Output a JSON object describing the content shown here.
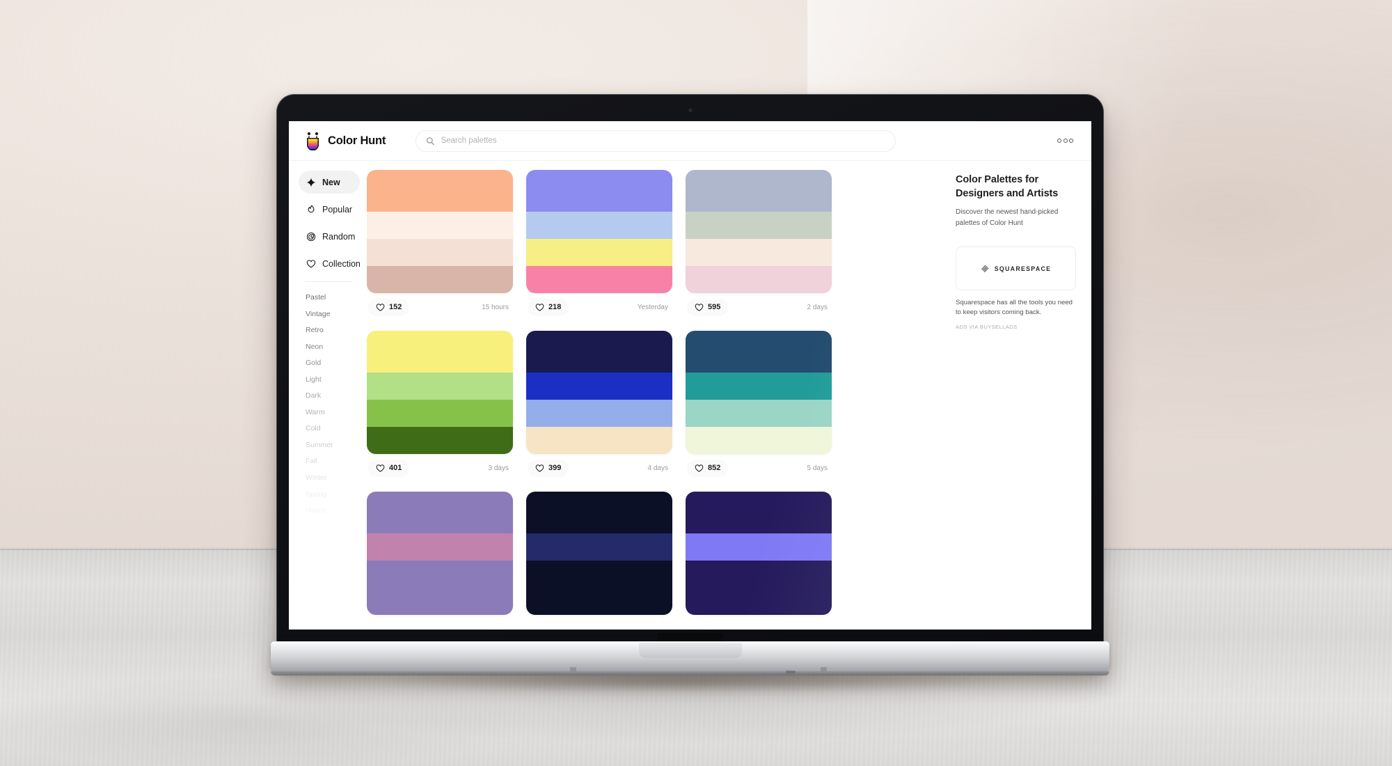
{
  "app": {
    "brand_name": "Color Hunt",
    "menu_icon": "more-horizontal-icon"
  },
  "search": {
    "placeholder": "Search palettes",
    "value": "",
    "icon": "search-icon"
  },
  "sidebar": {
    "nav": [
      {
        "label": "New",
        "icon": "sparkle-icon",
        "active": true
      },
      {
        "label": "Popular",
        "icon": "flame-icon",
        "active": false
      },
      {
        "label": "Random",
        "icon": "spiral-icon",
        "active": false
      },
      {
        "label": "Collection",
        "icon": "heart-icon",
        "active": false
      }
    ],
    "tags": [
      {
        "label": "Pastel",
        "opacity": 1.0
      },
      {
        "label": "Vintage",
        "opacity": 0.95
      },
      {
        "label": "Retro",
        "opacity": 0.9
      },
      {
        "label": "Neon",
        "opacity": 0.84
      },
      {
        "label": "Gold",
        "opacity": 0.76
      },
      {
        "label": "Light",
        "opacity": 0.68
      },
      {
        "label": "Dark",
        "opacity": 0.6
      },
      {
        "label": "Warm",
        "opacity": 0.52
      },
      {
        "label": "Cold",
        "opacity": 0.44
      },
      {
        "label": "Summer",
        "opacity": 0.34
      },
      {
        "label": "Fall",
        "opacity": 0.26
      },
      {
        "label": "Winter",
        "opacity": 0.18
      },
      {
        "label": "Spring",
        "opacity": 0.11
      },
      {
        "label": "Happy",
        "opacity": 0.06
      }
    ]
  },
  "palettes": [
    {
      "likes": "152",
      "time": "15 hours",
      "colors": [
        "#FAB38B",
        "#FDEFE5",
        "#F5E0D5",
        "#D8B5A8"
      ]
    },
    {
      "likes": "218",
      "time": "Yesterday",
      "colors": [
        "#8C8BF0",
        "#B4CBEF",
        "#F7EE85",
        "#F882A7"
      ]
    },
    {
      "likes": "595",
      "time": "2 days",
      "colors": [
        "#AEB7CC",
        "#C7D2C4",
        "#F7E9DD",
        "#EFD2DA"
      ]
    },
    {
      "likes": "401",
      "time": "3 days",
      "colors": [
        "#F8F07C",
        "#B1E086",
        "#86C council",
        "#3F6D17"
      ]
    },
    {
      "likes": "399",
      "time": "4 days",
      "colors": [
        "#1B1martin",
        "#1C2FC4",
        "#94AEEB",
        "#F7E4C4"
      ]
    },
    {
      "likes": "852",
      "time": "5 days",
      "colors": [
        "#234C6F",
        "#219C9A",
        "#9BD5C6",
        "#EFF6DA"
      ]
    },
    {
      "likes": "",
      "time": "",
      "colors": [
        "#8B7BB8",
        "#C182AE",
        "#8B7BB8",
        "#8B7BB8"
      ]
    },
    {
      "likes": "",
      "time": "",
      "colors": [
        "#0B1026",
        "#252A6B",
        "#0B1026",
        "#0B1026"
      ]
    },
    {
      "likes": "",
      "time": "",
      "colors": [
        "#241A5C",
        "#7F79F5",
        "#241A5C",
        "#241A5C"
      ]
    }
  ],
  "rail": {
    "title": "Color Palettes for Designers and Artists",
    "subtitle": "Discover the newest hand-picked palettes of Color Hunt",
    "ad_logo_name": "SQUARESPACE",
    "ad_logo_icon": "squarespace-icon",
    "ad_description": "Squarespace has all the tools you need to keep visitors coming back.",
    "ad_attribution": "ADS VIA BUYSELLADS"
  },
  "colors": {
    "page_background": "#ece3dd",
    "floor": "#dedddb",
    "accent_active_bg": "#f2f2f2",
    "text_primary": "#111111",
    "text_muted": "#9a9a9a"
  }
}
